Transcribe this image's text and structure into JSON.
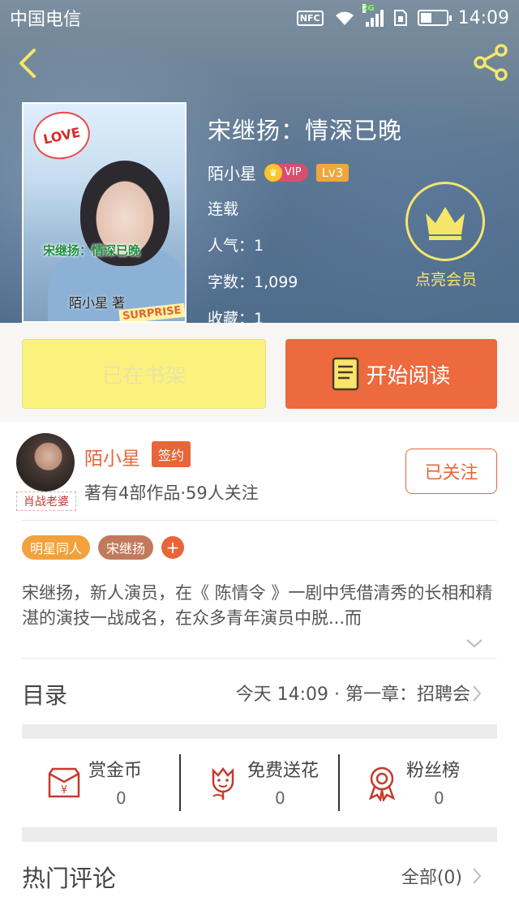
{
  "status_bar": {
    "carrier": "中国电信",
    "nfc": "NFC",
    "network": "2G",
    "time": "14:09"
  },
  "book": {
    "title": "宋继扬：情深已晚",
    "author": "陌小星",
    "vip": "VIP",
    "level": "Lv3",
    "status": "连载",
    "popularity": "人气：1",
    "word_count": "字数：1,099",
    "collections": "收藏：1",
    "cover": {
      "love_text": "LOVE",
      "title_text": "宋继扬：情深已晚",
      "author_text": "陌小星 著",
      "sticker_text": "SURPRISE"
    }
  },
  "member": {
    "label": "点亮会员"
  },
  "actions": {
    "shelf_label": "已在书架",
    "read_label": "开始阅读"
  },
  "author_info": {
    "name": "陌小星",
    "badge": "签约",
    "avatar_tag": "肖战老婆",
    "stats": "著有4部作品·59人关注",
    "follow_label": "已关注"
  },
  "tags": [
    "明星同人",
    "宋继扬"
  ],
  "tag_add": "+",
  "intro": "宋继扬，新人演员，在《 陈情令 》一剧中凭借清秀的长相和精湛的演技一战成名，在众多青年演员中脱...而",
  "toc": {
    "label": "目录",
    "latest": "今天 14:09 · 第一章：招聘会"
  },
  "stats": [
    {
      "label": "赏金币",
      "value": "0",
      "icon": "red-envelope-icon"
    },
    {
      "label": "免费送花",
      "value": "0",
      "icon": "flower-icon"
    },
    {
      "label": "粉丝榜",
      "value": "0",
      "icon": "medal-icon"
    }
  ],
  "comments": {
    "label": "热门评论",
    "all": "全部(0)"
  },
  "colors": {
    "accent": "#e8653a",
    "shelf_button": "#fbf27e",
    "member_gold": "#f5e66b"
  }
}
